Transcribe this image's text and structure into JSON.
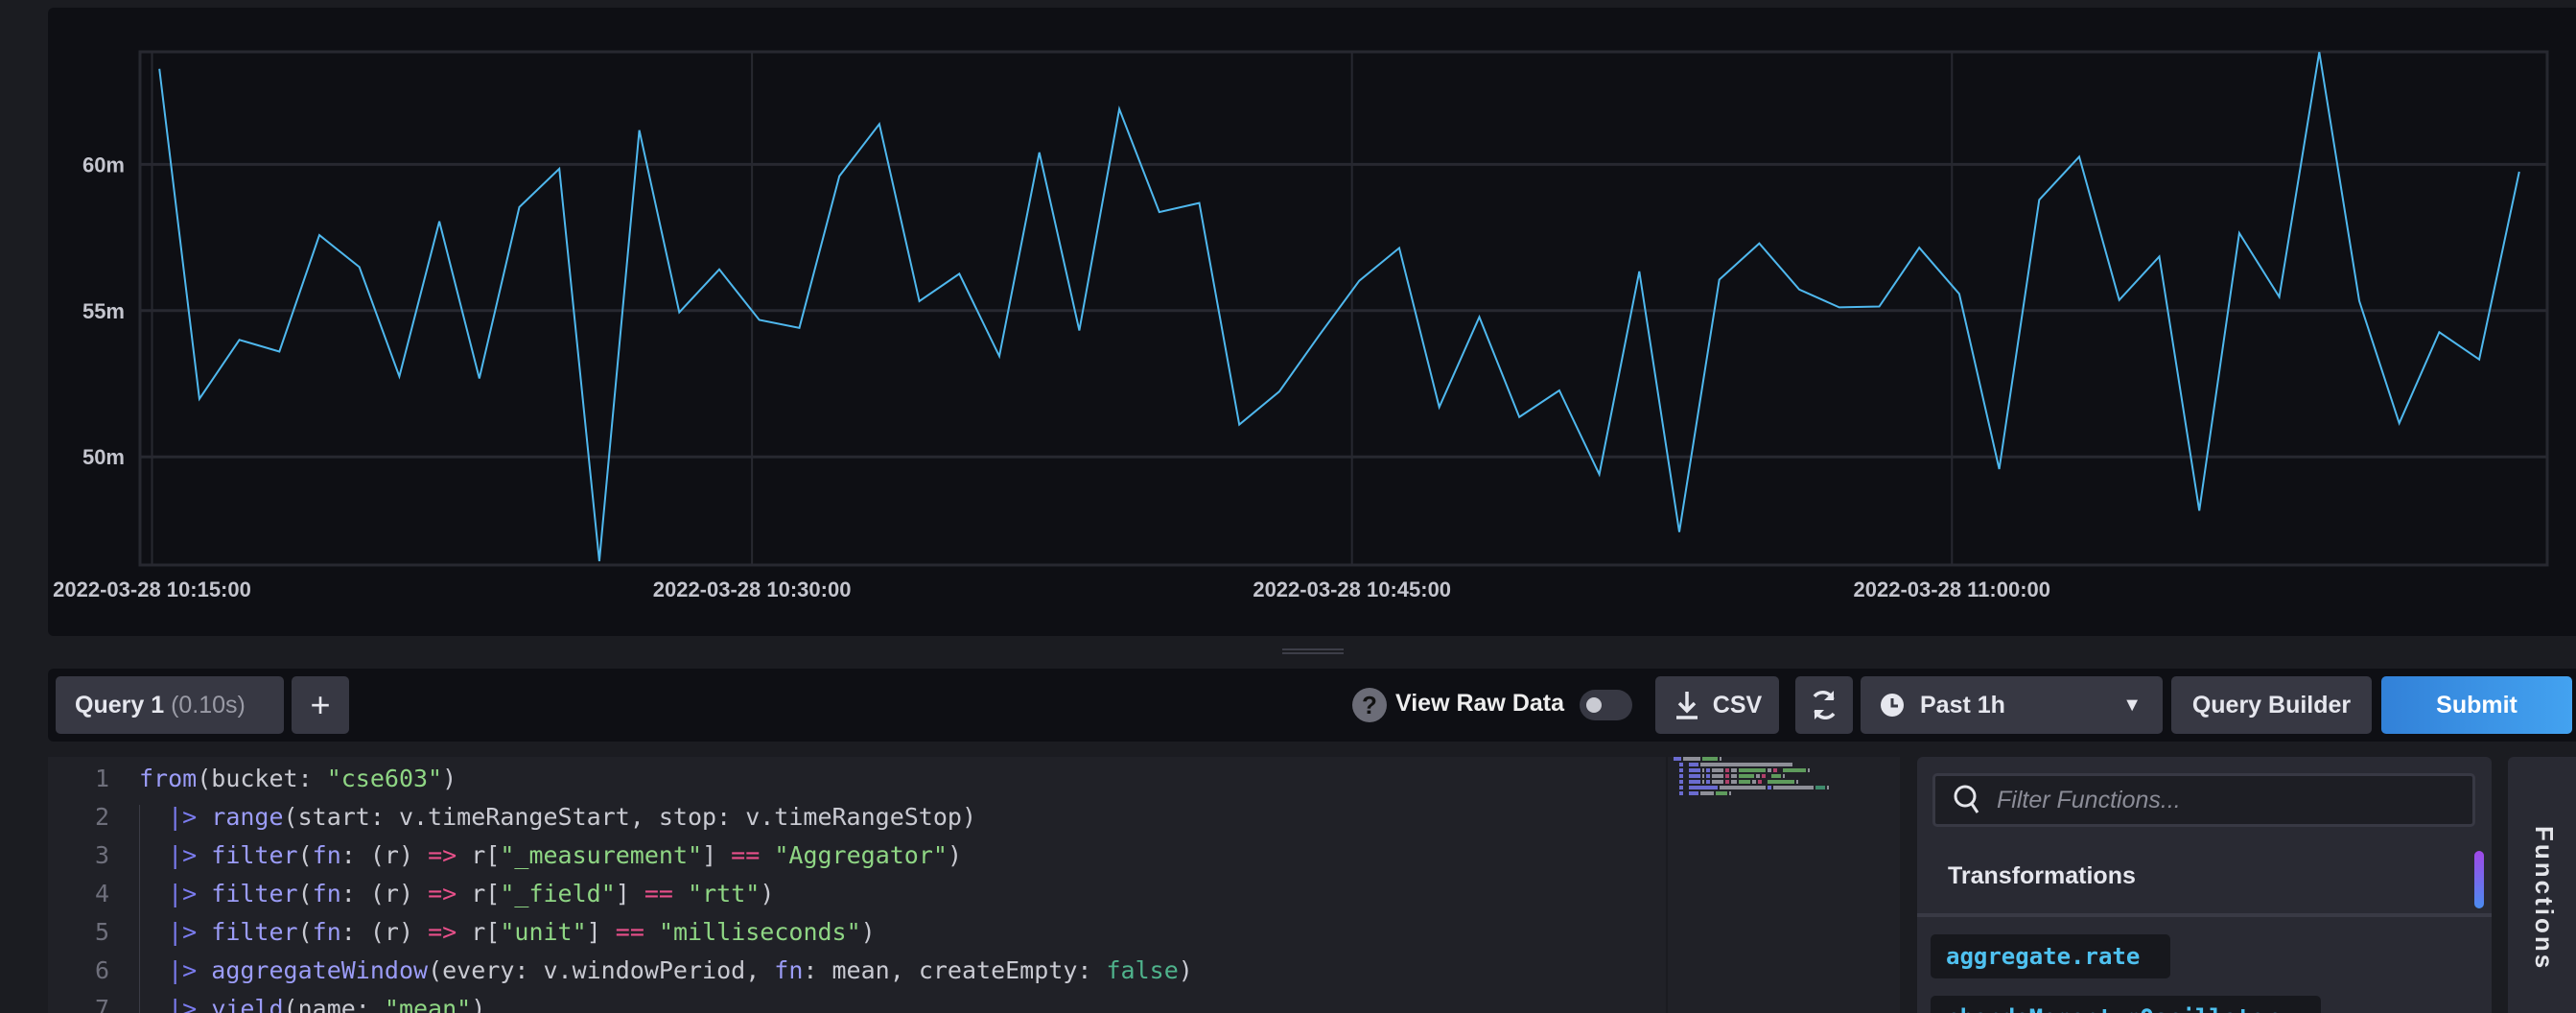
{
  "chart_data": {
    "type": "line",
    "date": "2022-03-28",
    "x": [
      "10:15:11",
      "10:16:11",
      "10:17:11",
      "10:18:11",
      "10:19:11",
      "10:20:11",
      "10:21:11",
      "10:22:11",
      "10:23:11",
      "10:24:11",
      "10:25:11",
      "10:26:11",
      "10:27:11",
      "10:28:11",
      "10:29:11",
      "10:30:11",
      "10:31:11",
      "10:32:11",
      "10:33:11",
      "10:34:11",
      "10:35:11",
      "10:36:11",
      "10:37:11",
      "10:38:11",
      "10:39:11",
      "10:40:11",
      "10:41:11",
      "10:42:11",
      "10:43:11",
      "10:44:11",
      "10:45:11",
      "10:46:11",
      "10:47:11",
      "10:48:11",
      "10:49:11",
      "10:50:11",
      "10:51:11",
      "10:52:11",
      "10:53:11",
      "10:54:11",
      "10:55:11",
      "10:56:11",
      "10:57:11",
      "10:58:11",
      "10:59:11",
      "11:00:11",
      "11:01:11",
      "11:02:11",
      "11:03:11",
      "11:04:11",
      "11:05:11",
      "11:06:11",
      "11:07:11",
      "11:08:11",
      "11:09:11",
      "11:10:11",
      "11:11:11",
      "11:12:11",
      "11:13:11",
      "11:14:11"
    ],
    "series": [
      {
        "color": "#4fb8ee",
        "values": [
          63.27,
          51.98,
          54.0,
          53.6,
          57.58,
          56.49,
          52.75,
          58.05,
          52.68,
          58.54,
          59.85,
          46.43,
          61.17,
          54.94,
          56.41,
          54.68,
          54.41,
          59.6,
          61.38,
          55.32,
          56.26,
          53.44,
          60.41,
          54.32,
          61.89,
          58.37,
          58.68,
          51.1,
          52.23,
          54.16,
          56.02,
          57.14,
          51.7,
          54.78,
          51.36,
          52.27,
          49.4,
          56.34,
          47.43,
          56.06,
          57.3,
          55.72,
          55.11,
          55.14,
          57.15,
          55.57,
          49.58,
          58.79,
          60.26,
          55.36,
          56.85,
          48.16,
          57.65,
          55.47,
          63.84,
          55.33,
          51.15,
          54.26,
          53.33,
          59.75
        ]
      }
    ],
    "y_unit_suffix": "m",
    "ylim": [
      46.3,
      63.85
    ],
    "xlim": [
      "10:14:42",
      "11:14:53"
    ],
    "y_ticks": [
      {
        "value": 50,
        "label": "50m"
      },
      {
        "value": 55,
        "label": "55m"
      },
      {
        "value": 60,
        "label": "60m"
      }
    ],
    "x_ticks": [
      {
        "value": "10:15:00",
        "label": "2022-03-28 10:15:00"
      },
      {
        "value": "10:30:00",
        "label": "2022-03-28 10:30:00"
      },
      {
        "value": "10:45:00",
        "label": "2022-03-28 10:45:00"
      },
      {
        "value": "11:00:00",
        "label": "2022-03-28 11:00:00"
      }
    ],
    "grid": true,
    "legend": "none"
  },
  "toolbar": {
    "query_tab": "Query 1",
    "query_time": "(0.10s)",
    "add_label": "+",
    "help_icon": "?",
    "view_raw_label": "View Raw Data",
    "view_raw_on": false,
    "csv_label": "CSV",
    "time_range": "Past 1h",
    "query_builder_label": "Query Builder",
    "submit_label": "Submit",
    "submit_color": "#3a90e5"
  },
  "editor": {
    "lines": [
      [
        [
          "fn",
          "from"
        ],
        [
          "plain",
          "(bucket: "
        ],
        [
          "str",
          "\"cse603\""
        ],
        [
          "plain",
          ")"
        ]
      ],
      [
        [
          "plain",
          "  "
        ],
        [
          "pipe",
          "|>"
        ],
        [
          "plain",
          " "
        ],
        [
          "fn",
          "range"
        ],
        [
          "plain",
          "(start: v.timeRangeStart, stop: v.timeRangeStop)"
        ]
      ],
      [
        [
          "plain",
          "  "
        ],
        [
          "pipe",
          "|>"
        ],
        [
          "plain",
          " "
        ],
        [
          "fn",
          "filter"
        ],
        [
          "plain",
          "("
        ],
        [
          "fn",
          "fn"
        ],
        [
          "plain",
          ": (r) "
        ],
        [
          "op",
          "=>"
        ],
        [
          "plain",
          " r["
        ],
        [
          "str",
          "\"_measurement\""
        ],
        [
          "plain",
          "] "
        ],
        [
          "op",
          "=="
        ],
        [
          "plain",
          " "
        ],
        [
          "str",
          "\"Aggregator\""
        ],
        [
          "plain",
          ")"
        ]
      ],
      [
        [
          "plain",
          "  "
        ],
        [
          "pipe",
          "|>"
        ],
        [
          "plain",
          " "
        ],
        [
          "fn",
          "filter"
        ],
        [
          "plain",
          "("
        ],
        [
          "fn",
          "fn"
        ],
        [
          "plain",
          ": (r) "
        ],
        [
          "op",
          "=>"
        ],
        [
          "plain",
          " r["
        ],
        [
          "str",
          "\"_field\""
        ],
        [
          "plain",
          "] "
        ],
        [
          "op",
          "=="
        ],
        [
          "plain",
          " "
        ],
        [
          "str",
          "\"rtt\""
        ],
        [
          "plain",
          ")"
        ]
      ],
      [
        [
          "plain",
          "  "
        ],
        [
          "pipe",
          "|>"
        ],
        [
          "plain",
          " "
        ],
        [
          "fn",
          "filter"
        ],
        [
          "plain",
          "("
        ],
        [
          "fn",
          "fn"
        ],
        [
          "plain",
          ": (r) "
        ],
        [
          "op",
          "=>"
        ],
        [
          "plain",
          " r["
        ],
        [
          "str",
          "\"unit\""
        ],
        [
          "plain",
          "] "
        ],
        [
          "op",
          "=="
        ],
        [
          "plain",
          " "
        ],
        [
          "str",
          "\"milliseconds\""
        ],
        [
          "plain",
          ")"
        ]
      ],
      [
        [
          "plain",
          "  "
        ],
        [
          "pipe",
          "|>"
        ],
        [
          "plain",
          " "
        ],
        [
          "fn",
          "aggregateWindow"
        ],
        [
          "plain",
          "(every: v.windowPeriod, "
        ],
        [
          "fn",
          "fn"
        ],
        [
          "plain",
          ": mean, createEmpty: "
        ],
        [
          "bool",
          "false"
        ],
        [
          "plain",
          ")"
        ]
      ],
      [
        [
          "plain",
          "  "
        ],
        [
          "pipe",
          "|>"
        ],
        [
          "plain",
          " "
        ],
        [
          "fn",
          "yield"
        ],
        [
          "plain",
          "(name: "
        ],
        [
          "str",
          "\"mean\""
        ],
        [
          "plain",
          ")"
        ]
      ]
    ]
  },
  "functions": {
    "filter_placeholder": "Filter Functions...",
    "section": "Transformations",
    "items": [
      "aggregate.rate",
      "chandeMomentumOscillator"
    ],
    "side_tab": "Functions"
  }
}
